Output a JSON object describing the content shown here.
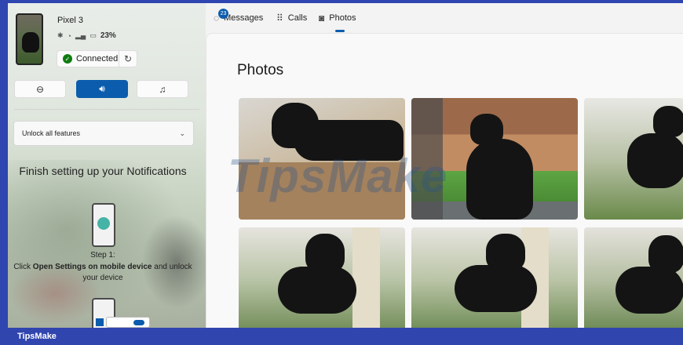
{
  "device": {
    "name": "Pixel 3",
    "battery": "23%",
    "connection_status": "Connected"
  },
  "controls": {
    "dnd_icon": "minus-circle-icon",
    "sound_icon": "speaker-icon",
    "music_icon": "music-note-icon"
  },
  "unlock": {
    "label": "Unlock all features"
  },
  "setup": {
    "title": "Finish setting up your Notifications",
    "step_label": "Step 1:",
    "step_prefix": "Click ",
    "step_bold": "Open Settings on mobile device",
    "step_suffix": " and unlock your device"
  },
  "nav": {
    "messages_label": "Messages",
    "messages_badge": "23",
    "calls_label": "Calls",
    "photos_label": "Photos",
    "active_tab": "Photos"
  },
  "content": {
    "title": "Photos"
  },
  "watermark": "TipsMake",
  "footer": {
    "brand": "TipsMake"
  },
  "colors": {
    "accent": "#0b5cad",
    "frame": "#2f45b0",
    "connected_green": "#0f7b0f"
  }
}
